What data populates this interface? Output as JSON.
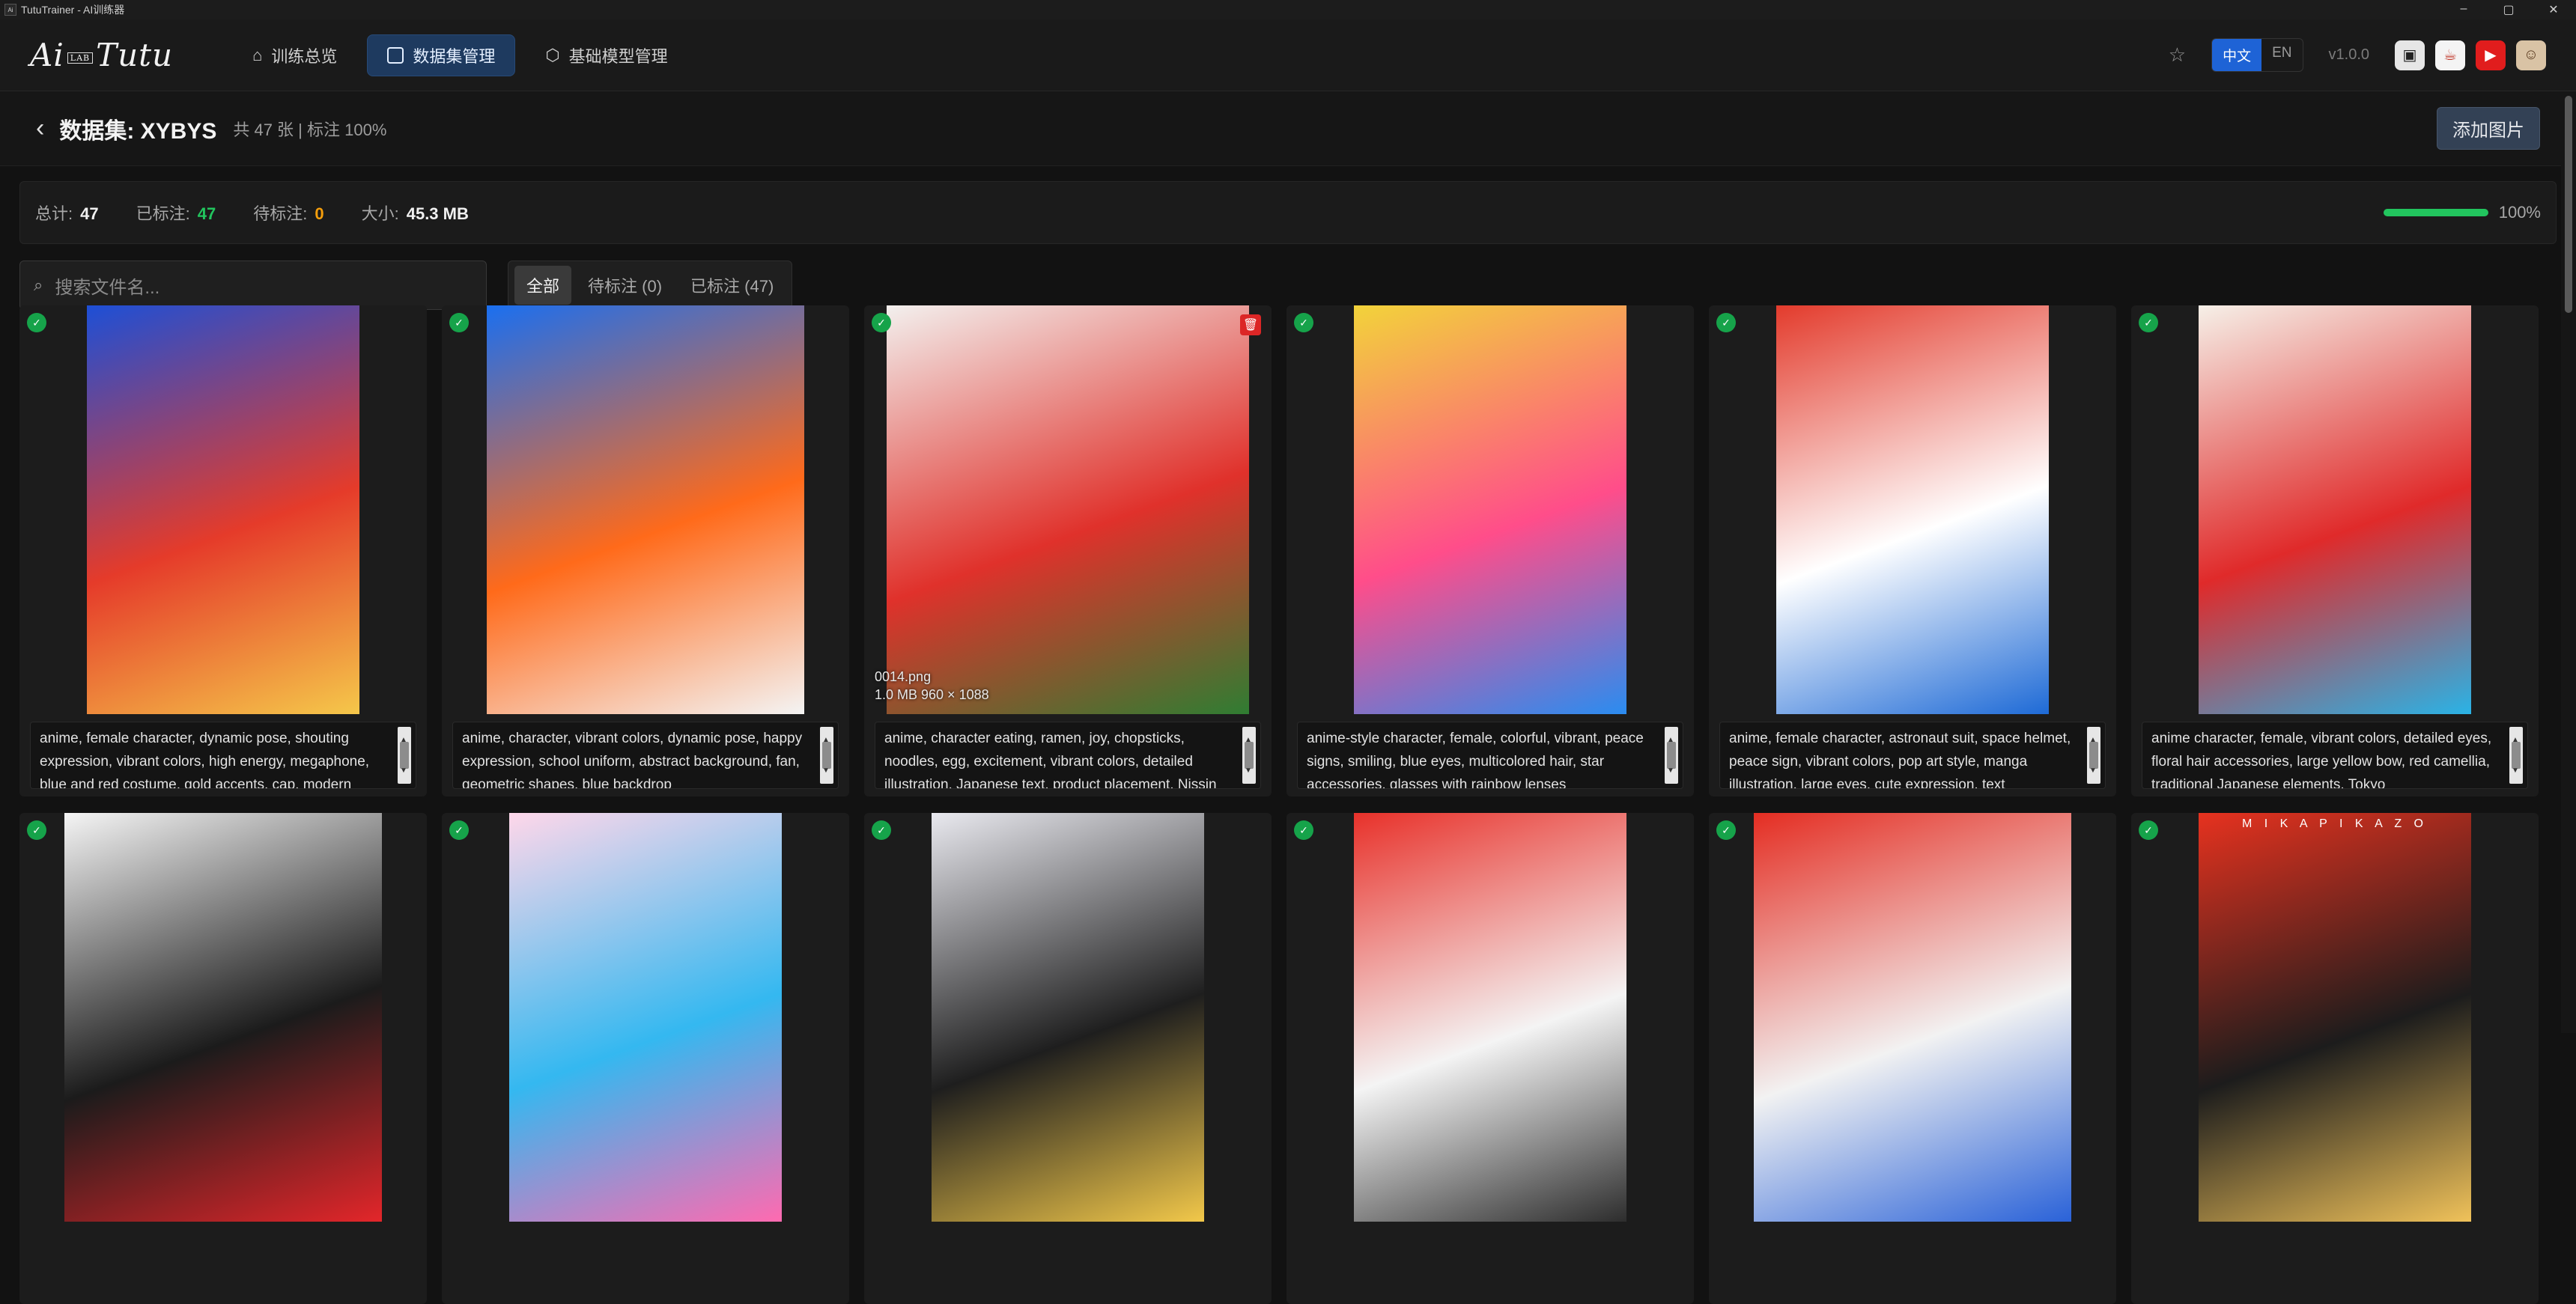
{
  "window": {
    "title": "TutuTrainer - AI训练器",
    "app_icon": "Ai"
  },
  "logo": {
    "text": "Ai",
    "lab": "LAB",
    "script": "Tutu"
  },
  "nav": {
    "tabs": [
      {
        "label": "训练总览",
        "icon": "home-icon"
      },
      {
        "label": "数据集管理",
        "icon": "images-icon"
      },
      {
        "label": "基础模型管理",
        "icon": "cube-icon"
      }
    ],
    "lang_zh": "中文",
    "lang_en": "EN",
    "version": "v1.0.0"
  },
  "header": {
    "title": "数据集: XYBYS",
    "meta": "共 47 张 | 标注 100%",
    "add_button": "添加图片"
  },
  "stats": {
    "total_label": "总计:",
    "total": "47",
    "tagged_label": "已标注:",
    "tagged": "47",
    "pending_label": "待标注:",
    "pending": "0",
    "size_label": "大小:",
    "size": "45.3 MB",
    "progress": "100%",
    "progress_value": 1.0
  },
  "search": {
    "placeholder": "搜索文件名..."
  },
  "filters": [
    "全部",
    "待标注 (0)",
    "已标注 (47)"
  ],
  "cards": [
    {
      "caption": "anime, female character, dynamic pose, shouting expression, vibrant colors, high energy, megaphone, blue and red costume, gold accents, cap, modern",
      "colors": [
        "#1d4fd6",
        "#e53b2a",
        "#f5c74a"
      ]
    },
    {
      "caption": "anime, character, vibrant colors, dynamic pose, happy expression, school uniform, abstract background, fan, geometric shapes, blue backdrop",
      "colors": [
        "#1a6ff0",
        "#ff6a1a",
        "#f4f4f4"
      ]
    },
    {
      "caption": "anime, character eating, ramen, joy, chopsticks, noodles, egg, excitement, vibrant colors, detailed illustration, Japanese text, product placement, Nissin",
      "colors": [
        "#f3f0ee",
        "#e0312b",
        "#2f7d32"
      ],
      "file_name": "0014.png",
      "file_meta": "1.0 MB 960 × 1088"
    },
    {
      "caption": "anime-style character, female, colorful, vibrant, peace signs, smiling, blue eyes, multicolored hair, star accessories, glasses with rainbow lenses",
      "colors": [
        "#f2d33a",
        "#ff4d8a",
        "#2a8cf0"
      ]
    },
    {
      "caption": "anime, female character, astronaut suit, space helmet, peace sign, vibrant colors, pop art style, manga illustration, large eyes, cute expression, text",
      "colors": [
        "#e33b2c",
        "#ffffff",
        "#1e6ad6"
      ]
    },
    {
      "caption": "anime character, female, vibrant colors, detailed eyes, floral hair accessories, large yellow bow, red camellia, traditional Japanese elements, Tokyo",
      "colors": [
        "#f6f0e8",
        "#e02a2a",
        "#2ab3e6"
      ]
    },
    {
      "caption": "",
      "colors": [
        "#f5f5f5",
        "#1b1b1b",
        "#e3262a"
      ]
    },
    {
      "caption": "",
      "colors": [
        "#ffd7ea",
        "#34b8f0",
        "#ff6ab0"
      ]
    },
    {
      "caption": "",
      "colors": [
        "#e9e9ef",
        "#1e1e1e",
        "#f2c84a"
      ]
    },
    {
      "caption": "",
      "colors": [
        "#e8312a",
        "#f4f4f4",
        "#2d2d2d"
      ]
    },
    {
      "caption": "",
      "colors": [
        "#e42d22",
        "#f2f2f2",
        "#2a62d8"
      ]
    },
    {
      "caption": "",
      "colors": [
        "#e7321f",
        "#1c1c1c",
        "#f0c25a"
      ],
      "watermark": "M I K A   P I K A Z O"
    }
  ]
}
